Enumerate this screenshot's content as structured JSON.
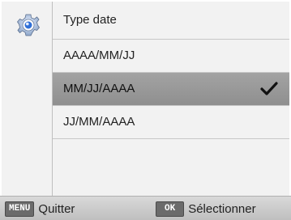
{
  "menu": {
    "icon": "settings-gear-icon",
    "title": "Type date",
    "options": [
      {
        "label": "AAAA/MM/JJ",
        "selected": false
      },
      {
        "label": "MM/JJ/AAAA",
        "selected": true
      },
      {
        "label": "JJ/MM/AAAA",
        "selected": false
      }
    ]
  },
  "footer": {
    "menu_key": "MENU",
    "menu_label": "Quitter",
    "ok_key": "OK",
    "ok_label": "Sélectionner"
  },
  "colors": {
    "selected_row": "#9a9a9a",
    "background": "#f2f2f2",
    "icon_blue": "#2f6fd6"
  }
}
